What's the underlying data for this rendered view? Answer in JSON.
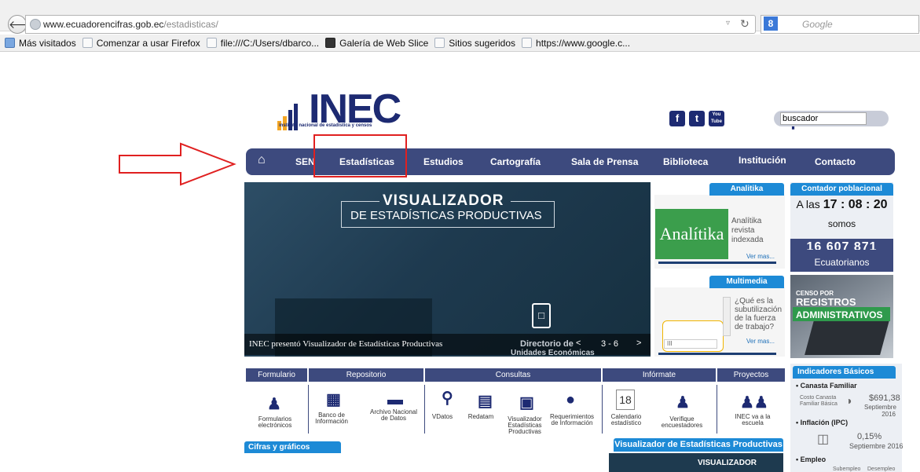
{
  "browser": {
    "url_host": "www.ecuadorencifras.gob.ec",
    "url_path": "/estadisticas/",
    "search_engine_placeholder": "Google",
    "google_glyph": "8",
    "bookmarks": [
      {
        "label": "Más visitados"
      },
      {
        "label": "Comenzar a usar Firefox"
      },
      {
        "label": "file:///C:/Users/dbarco..."
      },
      {
        "label": "Galería de Web Slice"
      },
      {
        "label": "Sitios sugeridos"
      },
      {
        "label": "https://www.google.c..."
      }
    ]
  },
  "header": {
    "logo_text": "INEC",
    "logo_sub": "instituto nacional de estadística y censos",
    "social": [
      "f",
      "t",
      "You Tube"
    ],
    "search_value": "buscador"
  },
  "nav": {
    "items": [
      {
        "label": "SEN"
      },
      {
        "label": "Estadísticas"
      },
      {
        "label": "Estudios"
      },
      {
        "label": "Cartografía"
      },
      {
        "label": "Sala de Prensa"
      },
      {
        "label": "Biblioteca"
      },
      {
        "label": "Institución"
      },
      {
        "label": "Contacto"
      }
    ],
    "highlighted": "Estadísticas"
  },
  "hero": {
    "title1": "VISUALIZADOR",
    "title2": "DE ESTADÍSTICAS PRODUCTIVAS",
    "caption": "INEC presentó Visualizador de Estadísticas Productivas",
    "side_caption": "Directorio de",
    "side_caption2": "Unidades Económicas",
    "pager": "3 - 6",
    "prev": "<",
    "next": ">"
  },
  "analitika": {
    "tab": "Analitika",
    "image_text": "Analítika",
    "text": "Analítika revista indexada",
    "more": "Ver mas..."
  },
  "multimedia": {
    "tab": "Multimedia",
    "text": "¿Qué es la subutilización de la fuerza de trabajo?",
    "more": "Ver mas...",
    "scroll_marker": "III"
  },
  "contador": {
    "tab": "Contador poblacional",
    "prefix": "A las",
    "time": "17 : 08 : 20",
    "somos": "somos",
    "number": "16 607 871",
    "suffix": "Ecuatorianos"
  },
  "censo": {
    "line1": "CENSO POR",
    "line2": "REGISTROS",
    "line3": "ADMINISTRATIVOS"
  },
  "sections": {
    "tabs": [
      "Formulario",
      "Repositorio",
      "Consultas",
      "Infórmate",
      "Proyectos"
    ],
    "items": [
      {
        "label": "Formularios electrónicos",
        "icon": "person-icon"
      },
      {
        "label": "Banco de Información",
        "icon": "bank-icon"
      },
      {
        "label": "Archivo Nacional de Datos",
        "icon": "folder-icon"
      },
      {
        "label": "VDatos",
        "icon": "magnifier-icon"
      },
      {
        "label": "Redatam",
        "icon": "laptop-icon"
      },
      {
        "label": "Visualizador Estadísticas Productivas",
        "icon": "building-icon"
      },
      {
        "label": "Requerimientos de Información",
        "icon": "operator-icon"
      },
      {
        "label": "Calendario estadístico",
        "icon": "calendar-icon",
        "day": "18"
      },
      {
        "label": "Verifique encuestadores",
        "icon": "verify-icon"
      },
      {
        "label": "INEC va a la escuela",
        "icon": "children-icon"
      }
    ]
  },
  "cifras": {
    "tab": "Cifras y gráficos"
  },
  "visualizador": {
    "tab": "Visualizador de Estadísticas Productivas",
    "mini": "VISUALIZADOR"
  },
  "indicadores": {
    "tab": "Indicadores Básicos",
    "canasta_title": "Canasta Familiar",
    "canasta_label": "Costo Canasta Familiar Básica",
    "canasta_value": "$691,38",
    "canasta_period": "Septiembre 2016",
    "inflacion_title": "Inflación (IPC)",
    "inflacion_value": "0,15%",
    "inflacion_period": "Septiembre 2016",
    "empleo_title": "Empleo",
    "empleo_sub1": "Subempleo",
    "empleo_sub2": "Desempleo"
  },
  "colors": {
    "navy": "#3d4a7e",
    "accent_blue": "#1d8ad6",
    "highlight_red": "#e02020",
    "logo_orange": "#f4a623"
  }
}
